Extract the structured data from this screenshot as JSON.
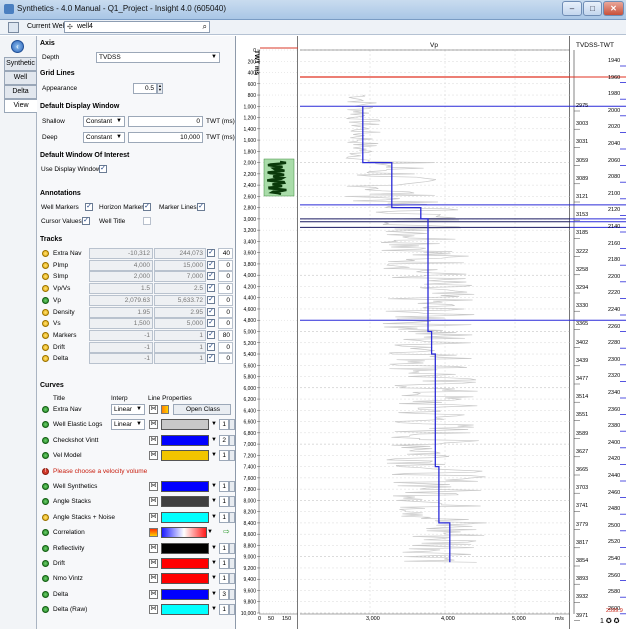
{
  "window": {
    "title": "Synthetics - 4.0 Manual - Q1_Project - Insight 4.0 (605040)",
    "minimize": "–",
    "maximize": "□",
    "close": "✕"
  },
  "toolbar": {
    "current_well_label": "Current Well",
    "current_well_value": "well4"
  },
  "left_tabs": [
    "Synthetic",
    "Well",
    "Delta",
    "View"
  ],
  "axis": {
    "section": "Axis",
    "depth_label": "Depth",
    "depth_value": "TVDSS"
  },
  "grid_lines": {
    "section": "Grid Lines",
    "appearance_label": "Appearance",
    "appearance_value": "0.5"
  },
  "default_display_window": {
    "section": "Default Display Window",
    "shallow_label": "Shallow",
    "shallow_mode": "Constant",
    "shallow_value": "0",
    "shallow_unit": "TWT (ms)",
    "deep_label": "Deep",
    "deep_mode": "Constant",
    "deep_value": "10,000",
    "deep_unit": "TWT (ms)"
  },
  "default_window_of_interest": {
    "section": "Default Window Of Interest",
    "use_display_label": "Use Display Window"
  },
  "annotations": {
    "section": "Annotations",
    "well_markers": "Well Markers",
    "horizon_markers": "Horizon Markers",
    "marker_lines": "Marker Lines",
    "cursor_values": "Cursor Values",
    "well_title": "Well Title"
  },
  "tracks": {
    "section": "Tracks",
    "rows": [
      {
        "name": "Extra Nav",
        "color": "yellow",
        "min": "-10,312",
        "max": "244,073",
        "width": "40"
      },
      {
        "name": "PImp",
        "color": "yellow",
        "min": "4,000",
        "max": "15,000",
        "width": "0"
      },
      {
        "name": "SImp",
        "color": "yellow",
        "min": "2,000",
        "max": "7,000",
        "width": "0"
      },
      {
        "name": "Vp/Vs",
        "color": "yellow",
        "min": "1.5",
        "max": "2.5",
        "width": "0"
      },
      {
        "name": "Vp",
        "color": "green",
        "min": "2,079.63",
        "max": "5,633.72",
        "width": "0"
      },
      {
        "name": "Density",
        "color": "yellow",
        "min": "1.95",
        "max": "2.95",
        "width": "0"
      },
      {
        "name": "Vs",
        "color": "yellow",
        "min": "1,500",
        "max": "5,000",
        "width": "0"
      },
      {
        "name": "Markers",
        "color": "yellow",
        "min": "-1",
        "max": "1",
        "width": "80"
      },
      {
        "name": "Drift",
        "color": "yellow",
        "min": "-1",
        "max": "1",
        "width": "0"
      },
      {
        "name": "Delta",
        "color": "yellow",
        "min": "-1",
        "max": "1",
        "width": "0"
      }
    ]
  },
  "curves": {
    "section": "Curves",
    "col_title": "Title",
    "col_interp": "Interp",
    "col_line": "Line Properties",
    "open_class": "Open Class",
    "velocity_warning": "Please choose a velocity volume",
    "rows": [
      {
        "name": "Extra Nav",
        "status": "green",
        "interp": "Linear",
        "kind": "class"
      },
      {
        "name": "Well Elastic Logs",
        "status": "green",
        "interp": "Linear",
        "kind": "swatch",
        "color": "#c8c8c8",
        "width": "1"
      },
      {
        "name": "Checkshot Vintt",
        "status": "green",
        "kind": "swatch",
        "color": "#0000ff",
        "width": "2"
      },
      {
        "name": "Vel Model",
        "status": "green",
        "kind": "swatch",
        "color": "#f2c400",
        "width": "1"
      },
      {
        "name": "Well Synthetics",
        "status": "green",
        "kind": "swatch",
        "color": "#0000ff",
        "width": "1"
      },
      {
        "name": "Angle Stacks",
        "status": "green",
        "kind": "swatch",
        "color": "#404040",
        "width": "1"
      },
      {
        "name": "Angle Stacks + Noise",
        "status": "yellow",
        "kind": "swatch",
        "color": "#00ffff",
        "width": "1"
      },
      {
        "name": "Correlation",
        "status": "green",
        "kind": "gradient"
      },
      {
        "name": "Reflectivity",
        "status": "green",
        "kind": "swatch",
        "color": "#000000",
        "width": "1"
      },
      {
        "name": "Drift",
        "status": "green",
        "kind": "swatch",
        "color": "#ff0000",
        "width": "1"
      },
      {
        "name": "Nmo Vintz",
        "status": "green",
        "kind": "swatch",
        "color": "#ff0000",
        "width": "1"
      },
      {
        "name": "Delta",
        "status": "green",
        "kind": "swatch",
        "color": "#0000ff",
        "width": "3"
      },
      {
        "name": "Delta (Raw)",
        "status": "green",
        "kind": "swatch",
        "color": "#00ffff",
        "width": "1"
      }
    ]
  },
  "plot": {
    "twt_label": "TWT ms",
    "twt_ticks": [
      "0",
      "200",
      "400",
      "600",
      "800",
      "1,000",
      "1,200",
      "1,400",
      "1,600",
      "1,800",
      "2,000",
      "2,200",
      "2,400",
      "2,600",
      "2,800",
      "3,000",
      "3,200",
      "3,400",
      "3,600",
      "3,800",
      "4,000",
      "4,200",
      "4,400",
      "4,600",
      "4,800",
      "5,000",
      "5,200",
      "5,400",
      "5,600",
      "5,800",
      "6,000",
      "6,200",
      "6,400",
      "6,600",
      "6,800",
      "7,000",
      "7,200",
      "7,400",
      "7,600",
      "7,800",
      "8,000",
      "8,200",
      "8,400",
      "8,600",
      "8,800",
      "9,000",
      "9,200",
      "9,400",
      "9,600",
      "9,800",
      "10,000"
    ],
    "nav_ticks": [
      "0",
      "50",
      "150"
    ],
    "vp_title": "Vp",
    "vp_ticks": [
      "3,000",
      "4,000",
      "5,000"
    ],
    "vp_unit": "m/s",
    "tvdss_title": "TVDSS-TWT",
    "tvdss_right": [
      "1940",
      "1960",
      "1980",
      "2000",
      "2020",
      "2040",
      "2060",
      "2080",
      "2100",
      "2120",
      "2140",
      "2160",
      "2180",
      "2200",
      "2220",
      "2240",
      "2260",
      "2280",
      "2300",
      "2320",
      "2340",
      "2360",
      "2380",
      "2400",
      "2420",
      "2440",
      "2460",
      "2480",
      "2500",
      "2520",
      "2540",
      "2560",
      "2580",
      "2600"
    ],
    "tvdss_left": [
      "2975",
      "3003",
      "3031",
      "3059",
      "3089",
      "3121",
      "3153",
      "3185",
      "3222",
      "3258",
      "3294",
      "3330",
      "3365",
      "3402",
      "3439",
      "3477",
      "3514",
      "3551",
      "3589",
      "3627",
      "3665",
      "3703",
      "3741",
      "3779",
      "3817",
      "3854",
      "3893",
      "3932",
      "3971"
    ],
    "tvdss_bottom": "2599.9",
    "chart_data": {
      "type": "line",
      "x_axis": "Vp (m/s)",
      "y_axis": "TWT ms",
      "ylim": [
        0,
        10000
      ],
      "xlim": [
        2079.63,
        5633.72
      ],
      "series": [
        {
          "name": "Checkshot Vintt",
          "points": [
            [
              2900,
              1000
            ],
            [
              2900,
              2000
            ],
            [
              3300,
              2000
            ],
            [
              3300,
              2800
            ],
            [
              3700,
              2800
            ],
            [
              3700,
              3000
            ],
            [
              3800,
              3000
            ],
            [
              3800,
              5000
            ],
            [
              3850,
              5000
            ],
            [
              3850,
              5400
            ],
            [
              3900,
              5400
            ],
            [
              3900,
              7400
            ],
            [
              3950,
              7400
            ],
            [
              3950,
              8400
            ],
            [
              4100,
              8400
            ],
            [
              4100,
              9100
            ]
          ]
        }
      ],
      "horizon_markers_ms": [
        480,
        1000,
        2750,
        3000,
        3050,
        3150,
        4800
      ]
    }
  }
}
